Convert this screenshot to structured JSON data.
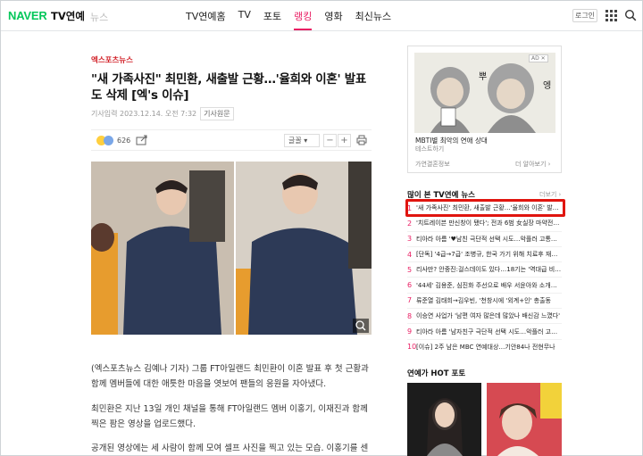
{
  "header": {
    "logo": "NAVER",
    "section": "TV연예",
    "sub": "뉴스",
    "nav": [
      "TV연예홈",
      "TV",
      "포토",
      "랭킹",
      "영화",
      "최신뉴스"
    ],
    "active_nav": "랭킹",
    "login": "로그인"
  },
  "article": {
    "press": "엑스포츠뉴스",
    "title": "\"새 가족사진\" 최민환, 새출발 근황…'율희와 이혼' 발표도 삭제 [엑's 이슈]",
    "date_label": "기사입력",
    "date": "2023.12.14. 오전 7:32",
    "original": "기사원문",
    "reaction_count": "626",
    "font_label": "글꼴",
    "minus": "−",
    "plus": "+",
    "paragraphs": [
      "(엑스포츠뉴스 김예나 기자) 그룹 FT아일랜드 최민환이 이혼 발표 후 첫 근황과 함께 멤버들에 대한 애틋한 마음을 엿보여 팬들의 응원을 자아냈다.",
      "최민환은 지난 13일 개인 채널을 통해 FT아일랜드 멤버 이홍기, 이재진과 함께 찍은 팜은 영상을 업로드했다.",
      "공개된 영상에는 세 사람이 함께 모여 셀프 사진을 찍고 있는 모습. 이홍기를 센"
    ]
  },
  "ad": {
    "badge": "AD ✕",
    "title": "MBTI별 최악의 연애 상대",
    "subtitle": "테스트하기",
    "foot_left": "가연결혼정보",
    "foot_right": "더 알아보기 ›"
  },
  "popular": {
    "heading": "많이 본 TV연예 뉴스",
    "more": "더보기 ›",
    "items": [
      {
        "num": "1",
        "text": "'새 가족사진' 최민환, 새출발 근황…'율희와 이혼' 발표…"
      },
      {
        "num": "2",
        "text": "'치트레이븐 만신창이 됐다'; 전과 6범 女실장 마약전…"
      },
      {
        "num": "3",
        "text": "티아라 아름 '♥남친 극단적 선택 시도…악플러 고통힘…"
      },
      {
        "num": "4",
        "text": "[단독] '4급→7급' 조병규, 한국 가기 위해 치료후 재활…"
      },
      {
        "num": "5",
        "text": "리사만? 안중진:걸스데이도 있다…18기는 '역대급 비주…"
      },
      {
        "num": "6",
        "text": "'44세' 김용준, 심진화 주선으로 배우 서윤아와 소개팅 '…"
      },
      {
        "num": "7",
        "text": "류준열 김태희→김우빈, '천창시에 '외계+인' 총출동"
      },
      {
        "num": "8",
        "text": "이승연 사업가 '남편 여자 많은데 많았나 배신감 느꼈다'"
      },
      {
        "num": "9",
        "text": "티아라 아름 '남자친구 극단적 선택 시도…악플러 고통힘…"
      },
      {
        "num": "10",
        "text": "[이슈] 2주 남은 MBC 연예대상…기안84나 전현무나"
      }
    ]
  },
  "hot": {
    "heading": "연예가 HOT 포토"
  }
}
